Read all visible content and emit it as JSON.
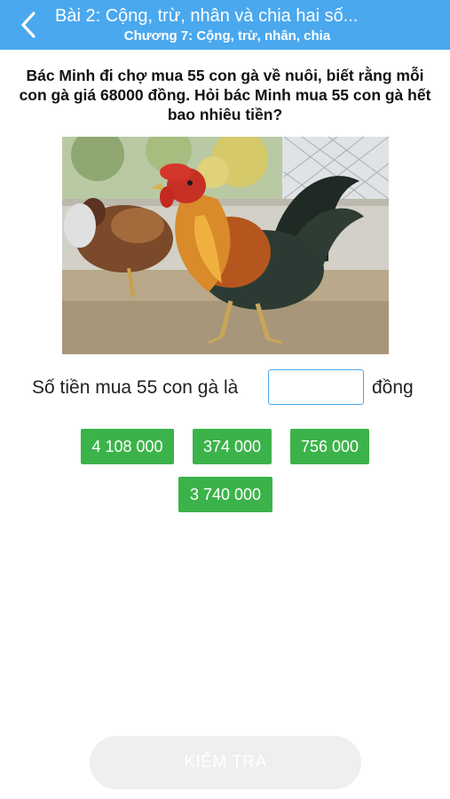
{
  "header": {
    "title": "Bài 2: Cộng, trừ, nhân và chia hai số...",
    "subtitle": "Chương 7: Cộng, trừ, nhân, chia",
    "back_icon": "chevron-left-icon"
  },
  "question": {
    "text": "Bác Minh đi chợ mua 55 con gà về nuôi, biết rằng mỗi con gà giá 68000 đồng. Hỏi bác Minh mua 55 con gà hết bao nhiêu tiền?"
  },
  "answer": {
    "prefix": "Số tiền mua 55 con gà là",
    "value": "",
    "suffix": "đồng"
  },
  "options": [
    "4 108 000",
    "374 000",
    "756 000",
    "3 740 000"
  ],
  "check_button": {
    "label": "KIỂM TRA",
    "enabled": false
  },
  "colors": {
    "header": "#4aa8ee",
    "option": "#3cb34a",
    "check_disabled": "#efefef"
  }
}
